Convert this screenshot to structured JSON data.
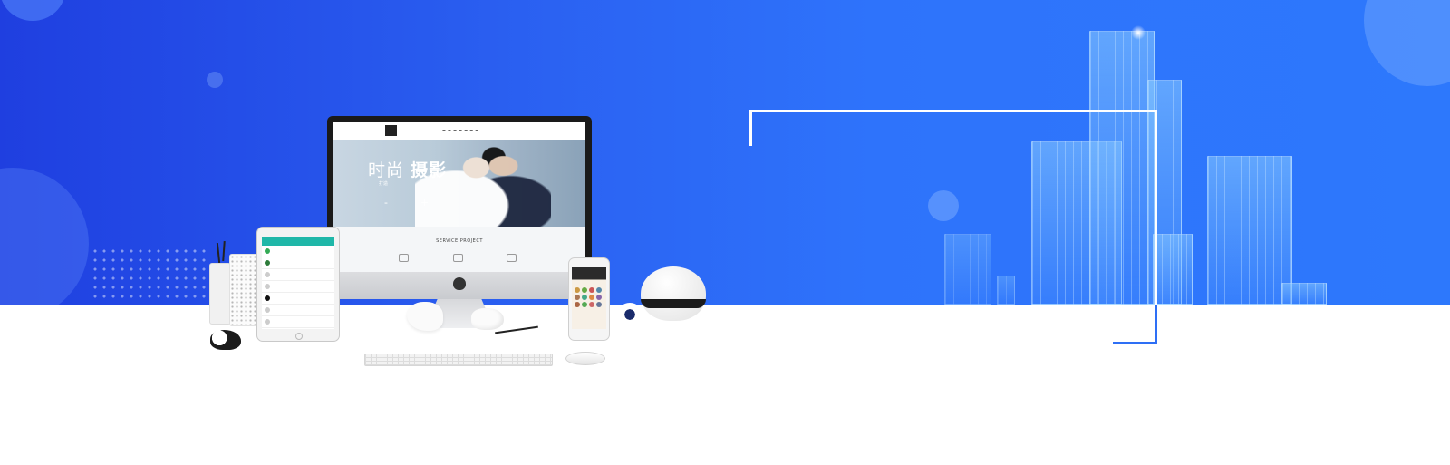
{
  "banner": {
    "colors": {
      "gradient_start": "#1f3fe0",
      "gradient_end": "#2d78fc",
      "floor": "#ffffff",
      "frame": "#ffffff"
    }
  },
  "website_mock": {
    "title_light": "时尚",
    "title_bold": "摄影",
    "subtitle": "打造",
    "prev_control": "-",
    "next_control": "+",
    "service_heading": "SERVICE PROJECT",
    "nav_icon": "logo-icon"
  },
  "devices": {
    "imac_logo_icon": "apple-icon",
    "tablet_accent": "#1fb7a8",
    "phone_accent": "#2b2b2b"
  }
}
